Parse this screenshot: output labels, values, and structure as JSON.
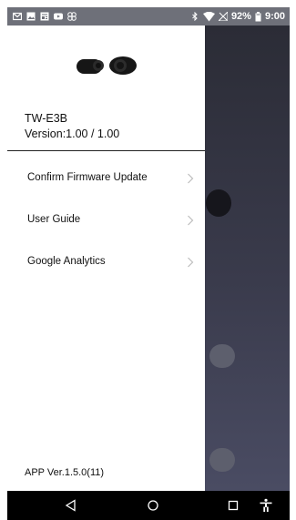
{
  "status_bar": {
    "battery": "92%",
    "time": "9:00",
    "icons": [
      "gmail-icon",
      "image-icon",
      "news-icon",
      "youtube-icon",
      "pinwheel-icon",
      "bluetooth-icon",
      "wifi-icon",
      "no-signal-icon",
      "battery-icon"
    ]
  },
  "drawer": {
    "device_name": "TW-E3B",
    "device_version": "Version:1.00 / 1.00",
    "menu": [
      {
        "label": "Confirm Firmware Update"
      },
      {
        "label": "User Guide"
      },
      {
        "label": "Google Analytics"
      }
    ],
    "app_version": "APP Ver.1.5.0(11)"
  },
  "nav_bar": {
    "buttons": [
      "back-icon",
      "home-icon",
      "recents-icon",
      "accessibility-icon"
    ]
  },
  "colors": {
    "status_bar_bg": "#6e7079",
    "drawer_bg": "#ffffff",
    "app_bg": "#2b2c36",
    "nav_bar_bg": "#000000"
  }
}
